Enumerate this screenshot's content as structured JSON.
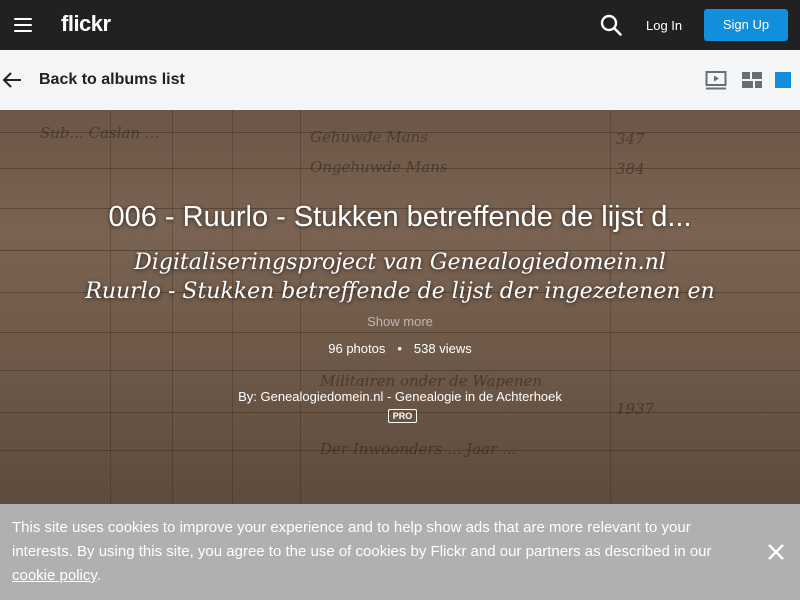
{
  "header": {
    "logo": "flickr",
    "login_label": "Log In",
    "signup_label": "Sign Up",
    "menu_icon": "hamburger-icon",
    "search_icon": "search-icon",
    "signup_color": "#128fdc"
  },
  "subnav": {
    "back_label": "Back to albums list",
    "back_icon": "arrow-left-icon",
    "view_icons": [
      "slideshow-icon",
      "grid-layout-icon",
      "square-view-icon"
    ],
    "active_view_color": "#128fdc"
  },
  "album": {
    "title": "006 - Ruurlo - Stukken betreffende de lijst d...",
    "description_line1": "Digitaliseringsproject van Genealogiedomein.nl",
    "description_line2": "Ruurlo - Stukken betreffende de lijst der ingezetenen en",
    "show_more": "Show more",
    "photos": "96 photos",
    "separator": "•",
    "views": "538 views",
    "byline": "By: Genealogiedomein.nl - Genealogie in de Achterhoek",
    "pro_badge": "PRO"
  },
  "cookie_banner": {
    "text": "This site uses cookies to improve your experience and to help show ads that are more relevant to your interests. By using this site, you agree to the use of cookies by Flickr and our partners as described in our ",
    "link_label": "cookie policy",
    "end": ".",
    "close_icon": "close-icon"
  }
}
